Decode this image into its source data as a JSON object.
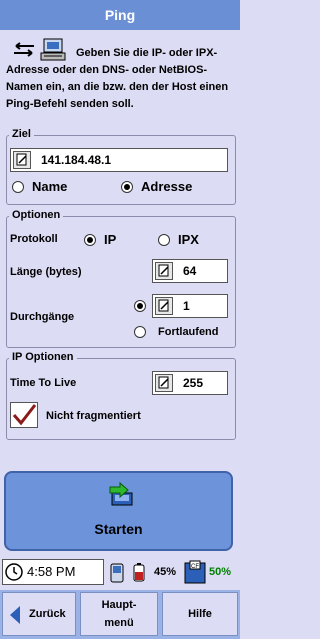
{
  "title": "Ping",
  "intro_text": "Geben Sie die IP- oder IPX-Adresse oder den DNS- oder NetBIOS-Namen ein, an die bzw. den der Host einen Ping-Befehl senden soll.",
  "ziel": {
    "legend": "Ziel",
    "address_value": "141.184.48.1",
    "option_name": "Name",
    "option_adresse": "Adresse",
    "selected": "Adresse"
  },
  "optionen": {
    "legend": "Optionen",
    "protokoll_label": "Protokoll",
    "protokoll_ip": "IP",
    "protokoll_ipx": "IPX",
    "protokoll_selected": "IP",
    "laenge_label": "Länge (bytes)",
    "laenge_value": "64",
    "durchgaenge_label": "Durchgänge",
    "durchgaenge_value": "1",
    "fortlaufend_label": "Fortlaufend",
    "durchgaenge_selected": "count"
  },
  "ip_optionen": {
    "legend": "IP Optionen",
    "ttl_label": "Time To Live",
    "ttl_value": "255",
    "nicht_fragmentiert_label": "Nicht fragmentiert",
    "nicht_fragmentiert_checked": true
  },
  "start_button_label": "Starten",
  "status": {
    "time": "4:58 PM",
    "battery": "45%",
    "storage": "50%",
    "storage_color": "#008000"
  },
  "bottom": {
    "back": "Zurück",
    "main_menu_line1": "Haupt-",
    "main_menu_line2": "menü",
    "help": "Hilfe"
  }
}
